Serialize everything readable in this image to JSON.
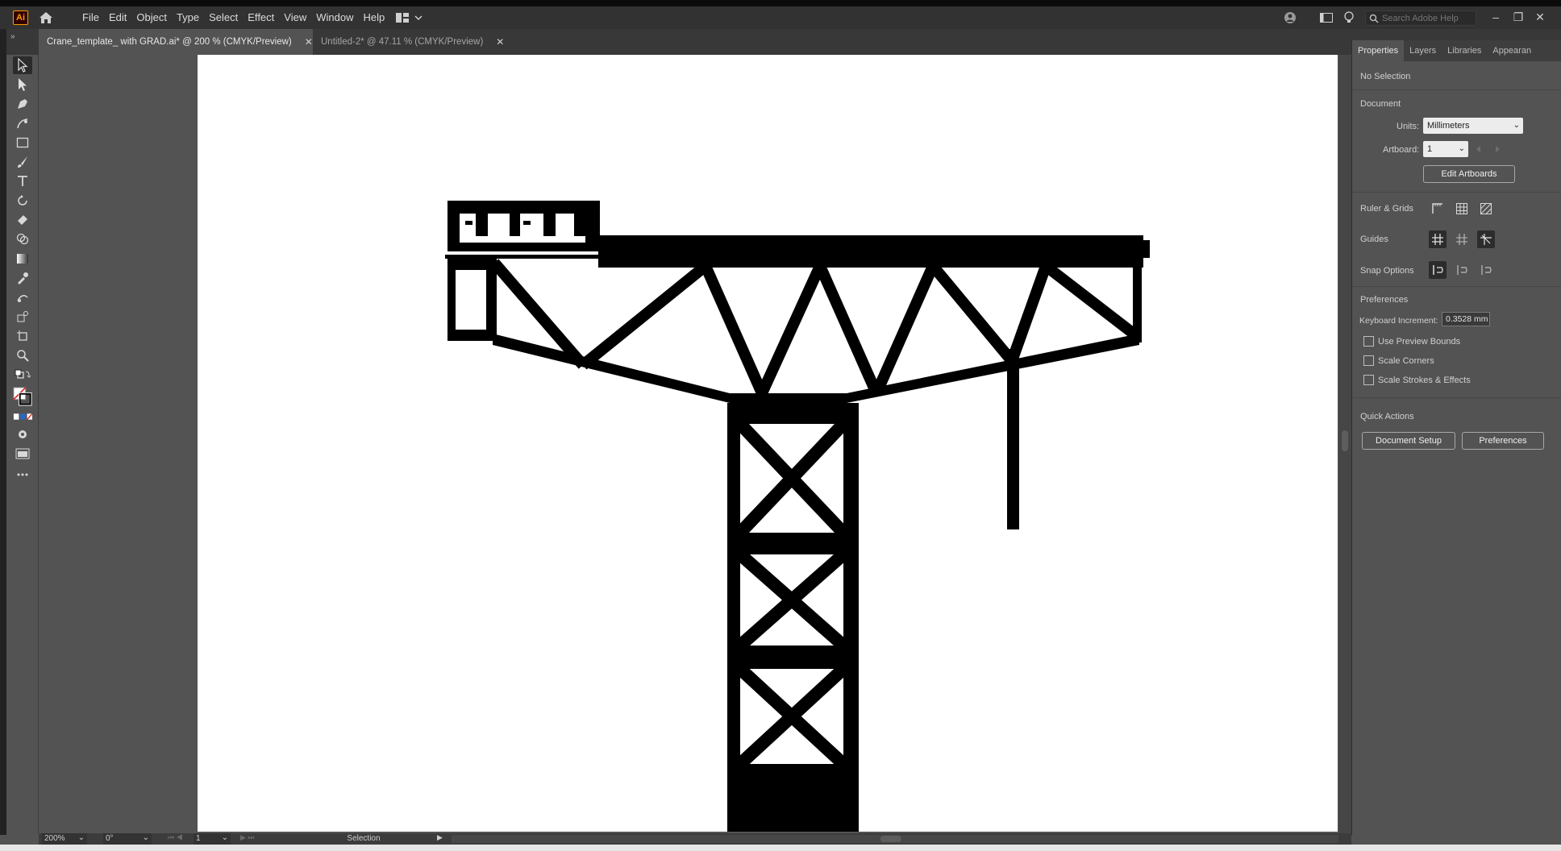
{
  "app": {
    "logo_text": "Ai",
    "menus": [
      "File",
      "Edit",
      "Object",
      "Type",
      "Select",
      "Effect",
      "View",
      "Window",
      "Help"
    ],
    "search_placeholder": "Search Adobe Help"
  },
  "tabs": [
    {
      "label": "Crane_template_ with GRAD.ai* @ 200 % (CMYK/Preview)",
      "active": true
    },
    {
      "label": "Untitled-2* @ 47.11 % (CMYK/Preview)",
      "active": false
    }
  ],
  "panel": {
    "tabs": [
      "Properties",
      "Layers",
      "Libraries",
      "Appearan"
    ],
    "selection_status": "No Selection",
    "document_heading": "Document",
    "units_label": "Units:",
    "units_value": "Millimeters",
    "artboard_label": "Artboard:",
    "artboard_value": "1",
    "edit_artboards": "Edit Artboards",
    "ruler_grids": "Ruler & Grids",
    "guides": "Guides",
    "snap_options": "Snap Options",
    "preferences_heading": "Preferences",
    "keyboard_increment_label": "Keyboard Increment:",
    "keyboard_increment_value": "0.3528 mm",
    "checkboxes": [
      "Use Preview Bounds",
      "Scale Corners",
      "Scale Strokes & Effects"
    ],
    "quick_actions": "Quick Actions",
    "document_setup": "Document Setup",
    "preferences_button": "Preferences"
  },
  "status": {
    "zoom": "200%",
    "rotation": "0°",
    "artboard_nav": "1",
    "tool": "Selection"
  }
}
